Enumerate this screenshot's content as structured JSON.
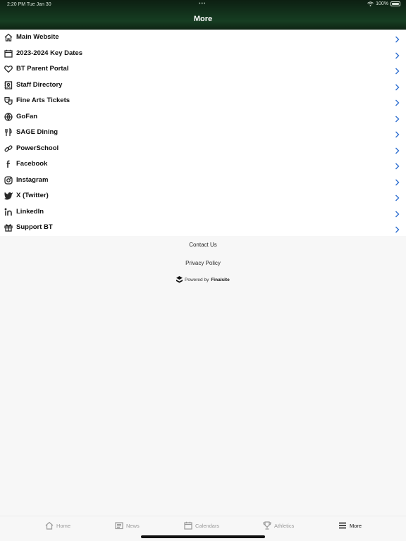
{
  "status_bar": {
    "time": "2:20 PM  Tue Jan 30",
    "dots": "•••",
    "battery": "100%"
  },
  "header": {
    "title": "More"
  },
  "menu": [
    {
      "label": "Main Website",
      "icon": "home-icon"
    },
    {
      "label": "2023-2024 Key Dates",
      "icon": "calendar-icon"
    },
    {
      "label": "BT Parent Portal",
      "icon": "heart-icon"
    },
    {
      "label": "Staff Directory",
      "icon": "directory-icon"
    },
    {
      "label": "Fine Arts Tickets",
      "icon": "theater-masks-icon"
    },
    {
      "label": "GoFan",
      "icon": "ball-icon"
    },
    {
      "label": "SAGE Dining",
      "icon": "utensils-icon"
    },
    {
      "label": "PowerSchool",
      "icon": "link-icon"
    },
    {
      "label": "Facebook",
      "icon": "facebook-icon"
    },
    {
      "label": "Instagram",
      "icon": "instagram-icon"
    },
    {
      "label": "X (Twitter)",
      "icon": "twitter-icon"
    },
    {
      "label": "LinkedIn",
      "icon": "linkedin-icon"
    },
    {
      "label": "Support BT",
      "icon": "gift-icon"
    }
  ],
  "footer": {
    "contact": "Contact Us",
    "privacy": "Privacy Policy",
    "powered_prefix": "Powered by",
    "powered_brand": "Finalsite"
  },
  "tabs": [
    {
      "label": "Home",
      "icon": "home-icon"
    },
    {
      "label": "News",
      "icon": "newspaper-icon"
    },
    {
      "label": "Calendars",
      "icon": "calendar-icon"
    },
    {
      "label": "Athletics",
      "icon": "trophy-icon"
    },
    {
      "label": "More",
      "icon": "hamburger-menu-icon",
      "active": true
    }
  ],
  "colors": {
    "header_green": "#163d22",
    "chevron_blue": "#2f6fd0"
  }
}
